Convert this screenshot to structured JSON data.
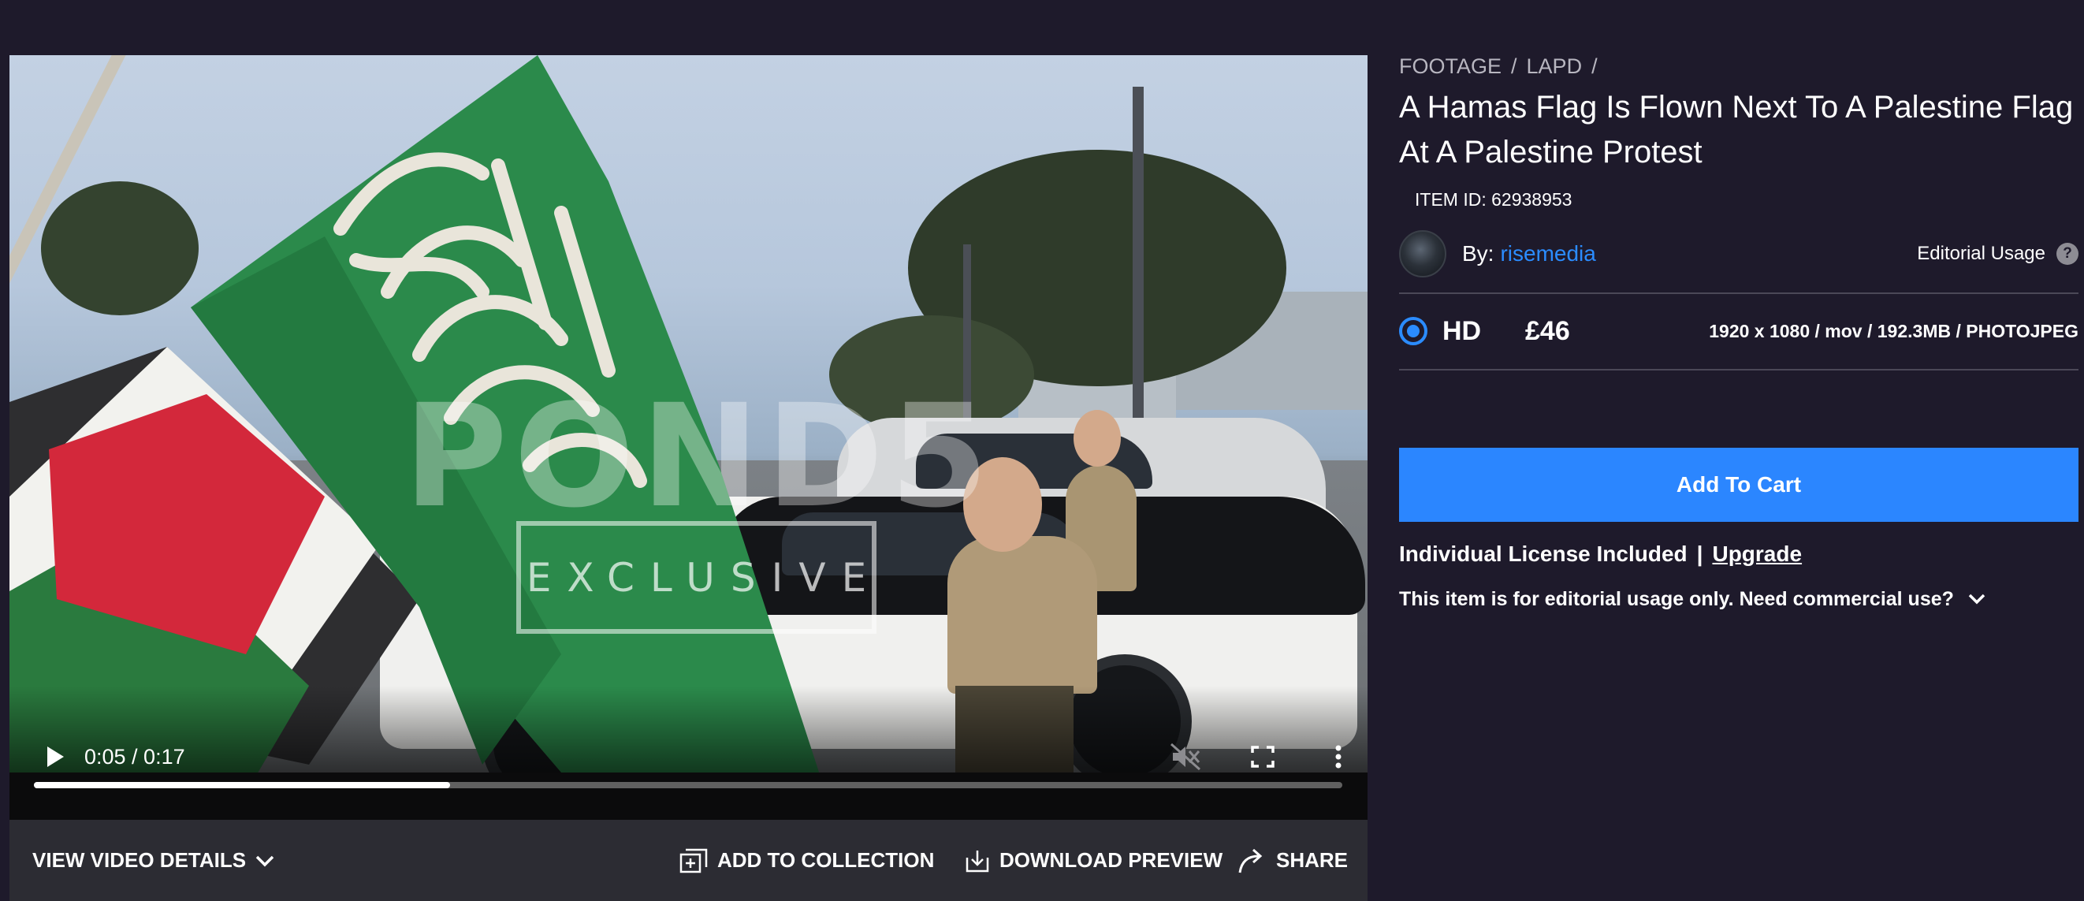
{
  "breadcrumb": {
    "items": [
      "FOOTAGE",
      "LAPD"
    ],
    "separator": "/"
  },
  "title": "A Hamas Flag Is Flown Next To A Palestine Flag At A Palestine Protest",
  "item_id": "ITEM ID: 62938953",
  "author": {
    "by_label": "By:",
    "name": "risemedia"
  },
  "usage": {
    "label": "Editorial Usage",
    "help_symbol": "?"
  },
  "option": {
    "format": "HD",
    "price": "£46",
    "spec": "1920 x 1080 / mov / 192.3MB / PHOTOJPEG",
    "selected": true
  },
  "cart": {
    "label": "Add To Cart"
  },
  "license": {
    "text": "Individual License Included",
    "separator": "|",
    "upgrade": "Upgrade"
  },
  "commercial": {
    "text": "This item is for editorial usage only. Need commercial use?"
  },
  "player": {
    "time": "0:05 / 0:17",
    "progress": 0.318,
    "watermark": "POND5",
    "badge": "EXCLUSIVE"
  },
  "actions": {
    "details": "VIEW VIDEO DETAILS",
    "collection": "ADD TO COLLECTION",
    "download": "DOWNLOAD PREVIEW",
    "share": "SHARE"
  },
  "colors": {
    "background": "#1e1a2b",
    "accent": "#2b86ff",
    "link": "#2b8cff",
    "action_strip": "#2c2c33"
  },
  "icons": {
    "play": "play-icon",
    "mute": "muted-speaker-icon",
    "fullscreen": "fullscreen-icon",
    "more": "more-vertical-icon",
    "details": "chevron-down-icon",
    "collection": "add-collection-icon",
    "download": "download-icon",
    "share": "share-arrow-icon",
    "commercial": "chevron-down-icon",
    "help": "help-icon"
  }
}
